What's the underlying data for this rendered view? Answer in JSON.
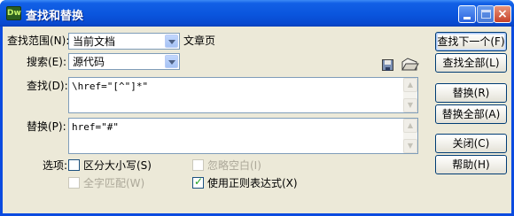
{
  "window": {
    "title": "查找和替换",
    "app_icon_text": "Dw",
    "controls": {
      "minimize": "minimize",
      "maximize": "maximize",
      "close": "×"
    }
  },
  "form": {
    "scope_label": "查找范围(N):",
    "scope_value": "当前文档",
    "scope_suffix": "文章页",
    "search_label": "搜索(E):",
    "search_value": "源代码",
    "find_label": "查找(D):",
    "find_value": "\\href=\"[^\"]*\"",
    "replace_label": "替换(P):",
    "replace_value": "href=\"#\"",
    "options_label": "选项:"
  },
  "options": {
    "match_case": {
      "label": "区分大小写(S)",
      "checked": false,
      "enabled": true
    },
    "ignore_whitespace": {
      "label": "忽略空白(I)",
      "checked": false,
      "enabled": false
    },
    "whole_word": {
      "label": "全字匹配(W)",
      "checked": false,
      "enabled": false
    },
    "use_regex": {
      "label": "使用正则表达式(X)",
      "checked": true,
      "enabled": true
    }
  },
  "buttons": {
    "find_next": "查找下一个(F)",
    "find_all": "查找全部(L)",
    "replace": "替换(R)",
    "replace_all": "替换全部(A)",
    "close": "关闭(C)",
    "help": "帮助(H)"
  },
  "icons": {
    "save_query": "save-icon",
    "open_query": "open-folder-icon"
  },
  "colors": {
    "titlebar": "#0a55dd",
    "dialog_bg": "#ece9d8",
    "check": "#21a121",
    "disabled_text": "#aca899"
  }
}
